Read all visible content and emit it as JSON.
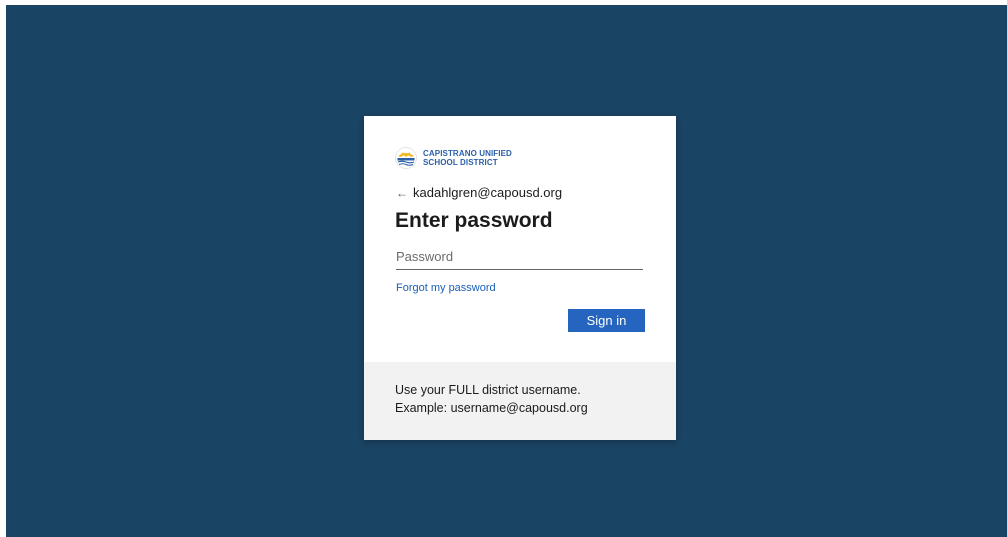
{
  "logo": {
    "line1": "CAPISTRANO UNIFIED",
    "line2": "SCHOOL DISTRICT",
    "icon": "district-logo-icon"
  },
  "identity": {
    "back_icon": "arrow-left-icon",
    "back_glyph": "←",
    "email": "kadahlgren@capousd.org"
  },
  "title": "Enter password",
  "password": {
    "value": "",
    "placeholder": "Password"
  },
  "forgot_label": "Forgot my password",
  "signin_label": "Sign in",
  "footer": {
    "line1": "Use your FULL district username.",
    "line2": "Example: username@capousd.org"
  },
  "colors": {
    "background": "#1a4463",
    "accent": "#2565c0",
    "link": "#1a5fb4",
    "footer_bg": "#f2f2f2"
  }
}
